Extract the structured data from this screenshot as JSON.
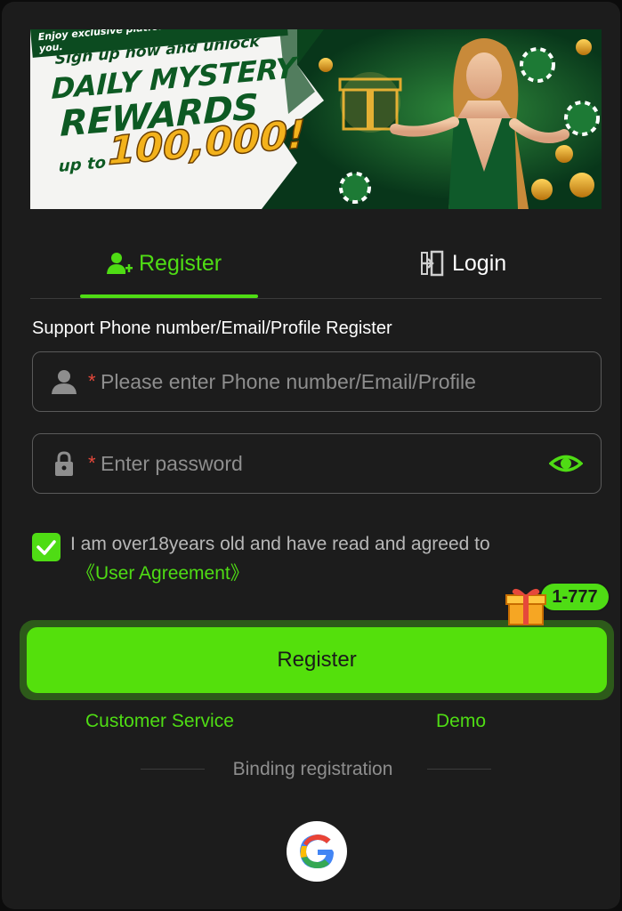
{
  "banner": {
    "subtitle": "Sign up now and unlock",
    "line1": "DAILY MYSTERY",
    "line2": "REWARDS",
    "upto": "up to",
    "amount": "100,000!",
    "tagline": "Enjoy exclusive platform rebates just for you."
  },
  "tabs": [
    {
      "label": "Register",
      "icon": "add-user-icon",
      "active": true
    },
    {
      "label": "Login",
      "icon": "login-door-icon",
      "active": false
    }
  ],
  "form": {
    "support_text": "Support Phone number/Email/Profile Register",
    "account_placeholder": "Please enter Phone number/Email/Profile",
    "password_placeholder": "Enter password",
    "required_mark": "*"
  },
  "agreement": {
    "checked": true,
    "text": "I am over18years old and have read and agreed to",
    "link": "《User Agreement》"
  },
  "bonus_badge": "1-777",
  "register_button": "Register",
  "links": {
    "customer_service": "Customer Service",
    "demo": "Demo"
  },
  "binding": {
    "label": "Binding registration",
    "providers": [
      "google-icon"
    ]
  },
  "colors": {
    "accent": "#4fdc14",
    "button": "#54e00c",
    "background": "#1c1c1c",
    "required": "#e5483b"
  }
}
